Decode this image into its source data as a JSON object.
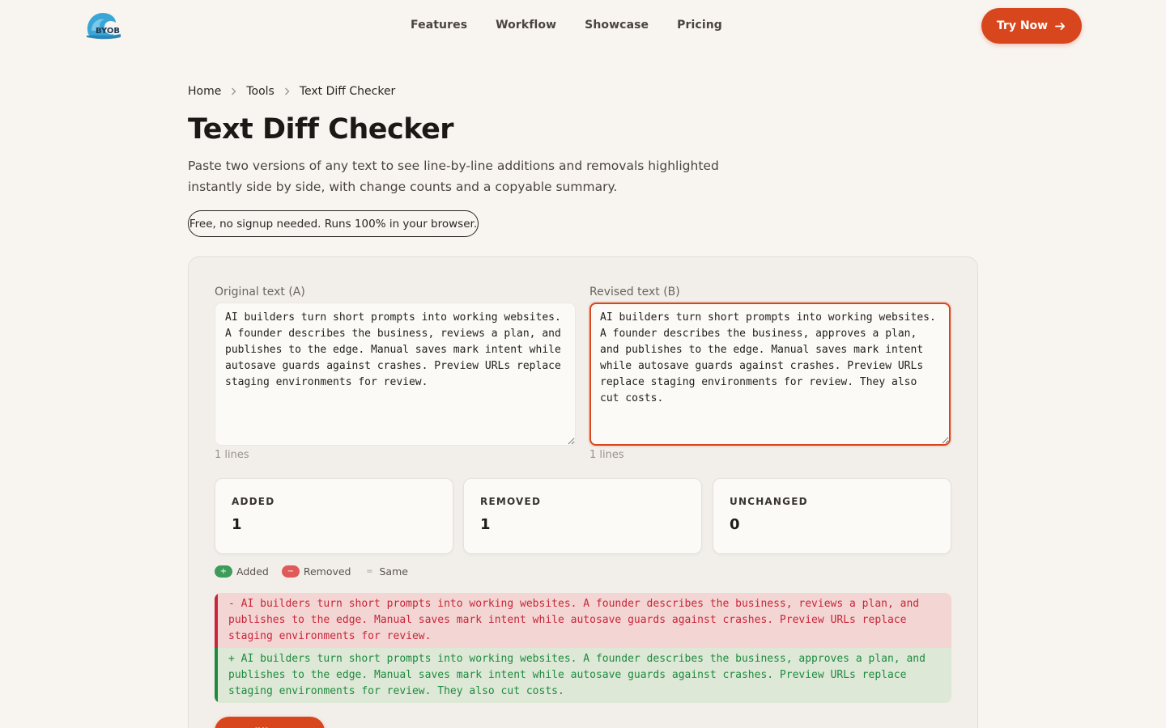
{
  "brand": {
    "logo_text": "BYOB"
  },
  "nav": {
    "items": [
      "Features",
      "Workflow",
      "Showcase",
      "Pricing"
    ],
    "cta_label": "Try Now"
  },
  "breadcrumb": [
    "Home",
    "Tools",
    "Text Diff Checker"
  ],
  "page": {
    "title": "Text Diff Checker",
    "description": "Paste two versions of any text to see line-by-line additions and removals highlighted instantly side by side, with change counts and a copyable summary.",
    "pill": "Free, no signup needed. Runs 100% in your browser."
  },
  "editor": {
    "original_label": "Original text (A)",
    "original_value": "AI builders turn short prompts into working websites. A founder describes the business, reviews a plan, and publishes to the edge. Manual saves mark intent while autosave guards against crashes. Preview URLs replace staging environments for review.",
    "original_lines": "1 lines",
    "revised_label": "Revised text (B)",
    "revised_value": "AI builders turn short prompts into working websites. A founder describes the business, approves a plan, and publishes to the edge. Manual saves mark intent while autosave guards against crashes. Preview URLs replace staging environments for review. They also cut costs.",
    "revised_lines": "1 lines"
  },
  "stats": [
    {
      "label": "ADDED",
      "value": "1"
    },
    {
      "label": "REMOVED",
      "value": "1"
    },
    {
      "label": "UNCHANGED",
      "value": "0"
    }
  ],
  "legend": {
    "added": "Added",
    "added_sym": "+",
    "removed": "Removed",
    "removed_sym": "−",
    "same": "Same",
    "same_sym": "="
  },
  "diff": {
    "removed": "- AI builders turn short prompts into working websites. A founder describes the business, reviews a plan, and publishes to the edge. Manual saves mark intent while autosave guards against crashes. Preview URLs replace staging environments for review.",
    "added": "+ AI builders turn short prompts into working websites. A founder describes the business, approves a plan, and publishes to the edge. Manual saves mark intent while autosave guards against crashes. Preview URLs replace staging environments for review. They also cut costs."
  },
  "copy_button": "Copy diff summary",
  "colors": {
    "accent": "#d8461e",
    "added": "#1f8a3e",
    "removed": "#c8253a"
  }
}
